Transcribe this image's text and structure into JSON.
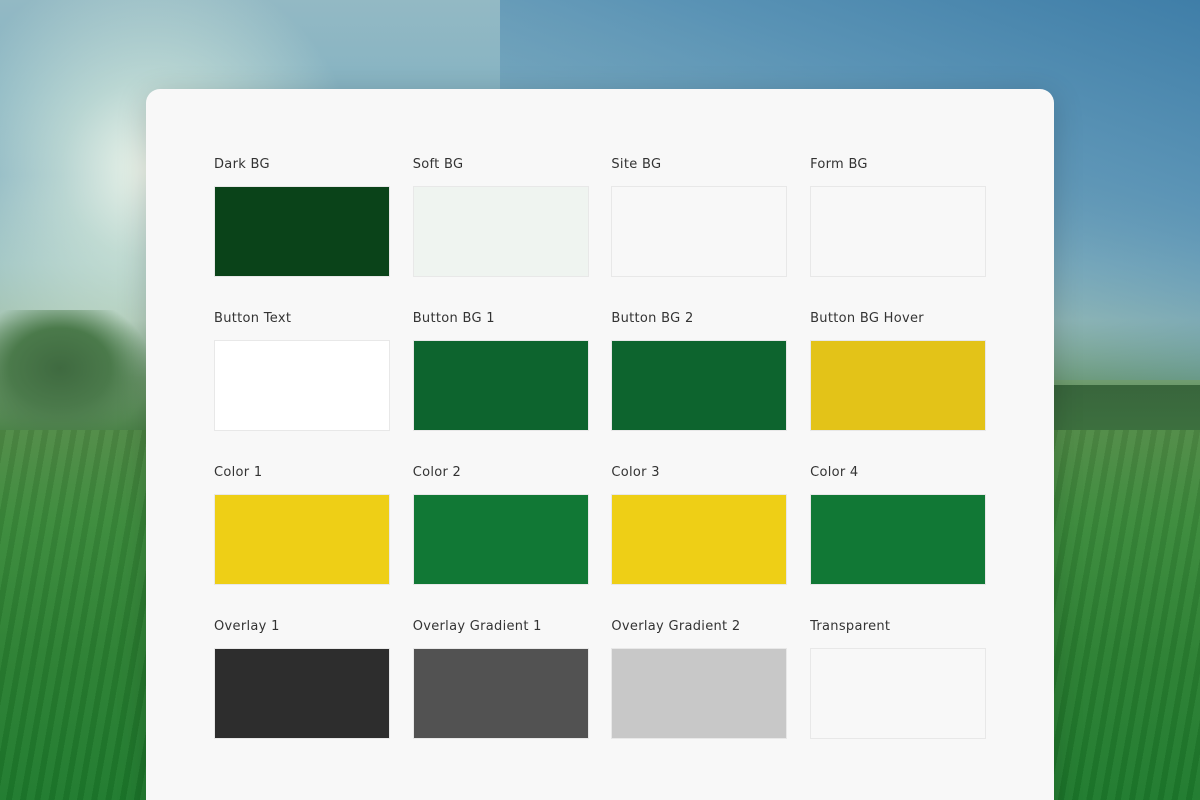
{
  "swatches": [
    {
      "label": "Dark BG",
      "color": "#0a4319"
    },
    {
      "label": "Soft BG",
      "color": "#eff4f0"
    },
    {
      "label": "Site BG",
      "color": "#f8f8f8"
    },
    {
      "label": "Form BG",
      "color": "#f8f8f8"
    },
    {
      "label": "Button Text",
      "color": "#ffffff"
    },
    {
      "label": "Button BG 1",
      "color": "#0d642e"
    },
    {
      "label": "Button BG 2",
      "color": "#0d642e"
    },
    {
      "label": "Button BG Hover",
      "color": "#e3c318"
    },
    {
      "label": "Color 1",
      "color": "#eecf16"
    },
    {
      "label": "Color 2",
      "color": "#117835"
    },
    {
      "label": "Color 3",
      "color": "#eecf16"
    },
    {
      "label": "Color 4",
      "color": "#117835"
    },
    {
      "label": "Overlay 1",
      "color": "#2d2d2d"
    },
    {
      "label": "Overlay Gradient 1",
      "color": "#525252"
    },
    {
      "label": "Overlay Gradient 2",
      "color": "#c8c8c8"
    },
    {
      "label": "Transparent",
      "color": "#f8f8f8"
    }
  ]
}
